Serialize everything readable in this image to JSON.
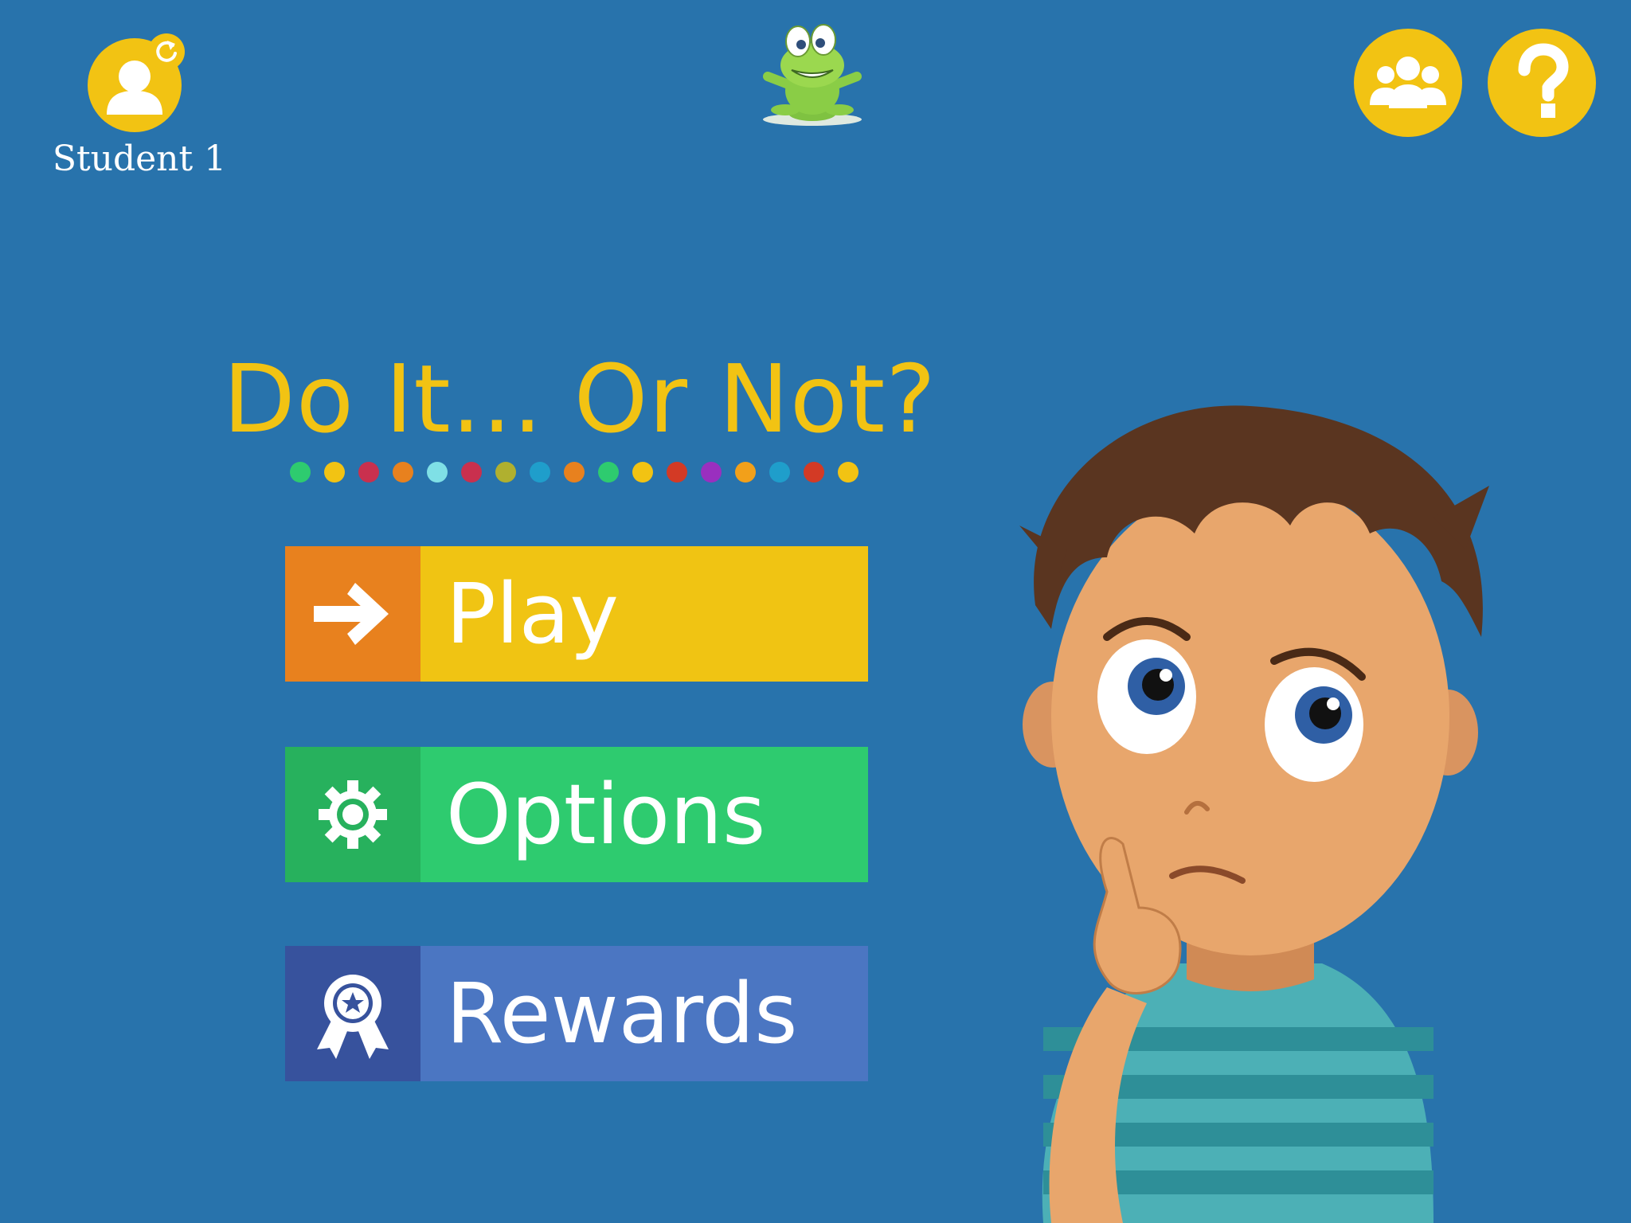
{
  "profile": {
    "label": "Student 1",
    "icon": "user-icon",
    "badge_icon": "refresh-icon"
  },
  "header": {
    "logo_icon": "frog-logo-icon",
    "group_button_icon": "group-icon",
    "help_button_icon": "question-mark-icon"
  },
  "title": "Do It... Or Not?",
  "title_dot_colors": [
    "#2ecb6f",
    "#f2c313",
    "#c9304e",
    "#e8811e",
    "#7fe0e6",
    "#c9304e",
    "#b0b02f",
    "#1f9ecb",
    "#e8811e",
    "#2ecb6f",
    "#f2c313",
    "#d33a25",
    "#9a2fbf",
    "#f2a01a",
    "#1f9ecb",
    "#d33a25",
    "#f2c313"
  ],
  "menu": {
    "play": {
      "label": "Play",
      "icon": "arrow-right-icon"
    },
    "options": {
      "label": "Options",
      "icon": "gear-icon"
    },
    "rewards": {
      "label": "Rewards",
      "icon": "award-ribbon-icon"
    }
  },
  "colors": {
    "background": "#2873ac",
    "accent_yellow": "#f2c313",
    "play_main": "#f0c413",
    "play_icon_bg": "#e8811e",
    "options_main": "#2ecb6f",
    "options_icon_bg": "#27b15d",
    "rewards_main": "#4b76c2",
    "rewards_icon_bg": "#37529d"
  },
  "illustration": "thinking-boy-character"
}
